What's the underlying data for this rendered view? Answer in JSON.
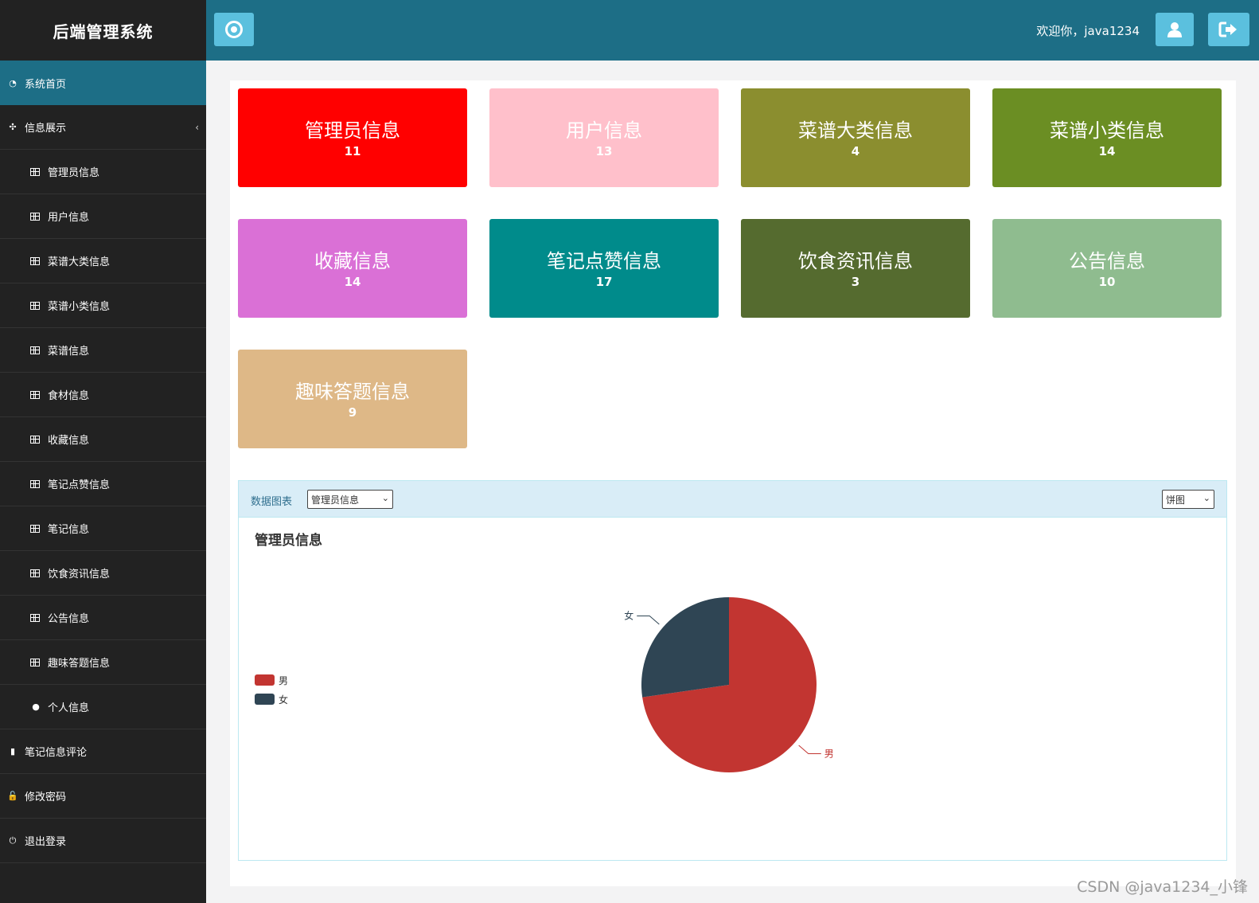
{
  "sidebar": {
    "brand": "后端管理系统",
    "items": [
      {
        "label": "系统首页",
        "icon": "dashboard-icon",
        "type": "top",
        "active": true
      },
      {
        "label": "信息展示",
        "icon": "sitemap-icon",
        "type": "top",
        "expand": "‹"
      },
      {
        "label": "管理员信息",
        "icon": "table-icon",
        "type": "sub"
      },
      {
        "label": "用户信息",
        "icon": "table-icon",
        "type": "sub"
      },
      {
        "label": "菜谱大类信息",
        "icon": "table-icon",
        "type": "sub"
      },
      {
        "label": "菜谱小类信息",
        "icon": "table-icon",
        "type": "sub"
      },
      {
        "label": "菜谱信息",
        "icon": "table-icon",
        "type": "sub"
      },
      {
        "label": "食材信息",
        "icon": "table-icon",
        "type": "sub"
      },
      {
        "label": "收藏信息",
        "icon": "table-icon",
        "type": "sub"
      },
      {
        "label": "笔记点赞信息",
        "icon": "table-icon",
        "type": "sub"
      },
      {
        "label": "笔记信息",
        "icon": "table-icon",
        "type": "sub"
      },
      {
        "label": "饮食资讯信息",
        "icon": "table-icon",
        "type": "sub"
      },
      {
        "label": "公告信息",
        "icon": "table-icon",
        "type": "sub"
      },
      {
        "label": "趣味答题信息",
        "icon": "table-icon",
        "type": "sub"
      },
      {
        "label": "个人信息",
        "icon": "user-icon",
        "type": "sub"
      },
      {
        "label": "笔记信息评论",
        "icon": "file-icon",
        "type": "top"
      },
      {
        "label": "修改密码",
        "icon": "lock-icon",
        "type": "top"
      },
      {
        "label": "退出登录",
        "icon": "power-icon",
        "type": "top"
      }
    ]
  },
  "header": {
    "welcome": "欢迎你，java1234",
    "home_icon": "dot-circle-icon",
    "user_icon": "user-icon",
    "logout_icon": "sign-out-icon"
  },
  "cards": [
    {
      "title": "管理员信息",
      "count": "11",
      "color": "#ff0000"
    },
    {
      "title": "用户信息",
      "count": "13",
      "color": "#ffc0cb"
    },
    {
      "title": "菜谱大类信息",
      "count": "4",
      "color": "#8b8e2f"
    },
    {
      "title": "菜谱小类信息",
      "count": "14",
      "color": "#6b8e23"
    },
    {
      "title": "收藏信息",
      "count": "14",
      "color": "#da70d6"
    },
    {
      "title": "笔记点赞信息",
      "count": "17",
      "color": "#008b8b"
    },
    {
      "title": "饮食资讯信息",
      "count": "3",
      "color": "#556b2f"
    },
    {
      "title": "公告信息",
      "count": "10",
      "color": "#8fbc8f"
    },
    {
      "title": "趣味答题信息",
      "count": "9",
      "color": "#deb887"
    }
  ],
  "chart_panel": {
    "label": "数据图表",
    "table_select": "管理员信息",
    "type_select": "饼图"
  },
  "chart_data": {
    "type": "pie",
    "title": "管理员信息",
    "series": [
      {
        "name": "男",
        "value": 8,
        "color": "#c23531"
      },
      {
        "name": "女",
        "value": 3,
        "color": "#2f4554"
      }
    ],
    "legend_position": "left"
  },
  "watermark": "CSDN @java1234_小锋"
}
